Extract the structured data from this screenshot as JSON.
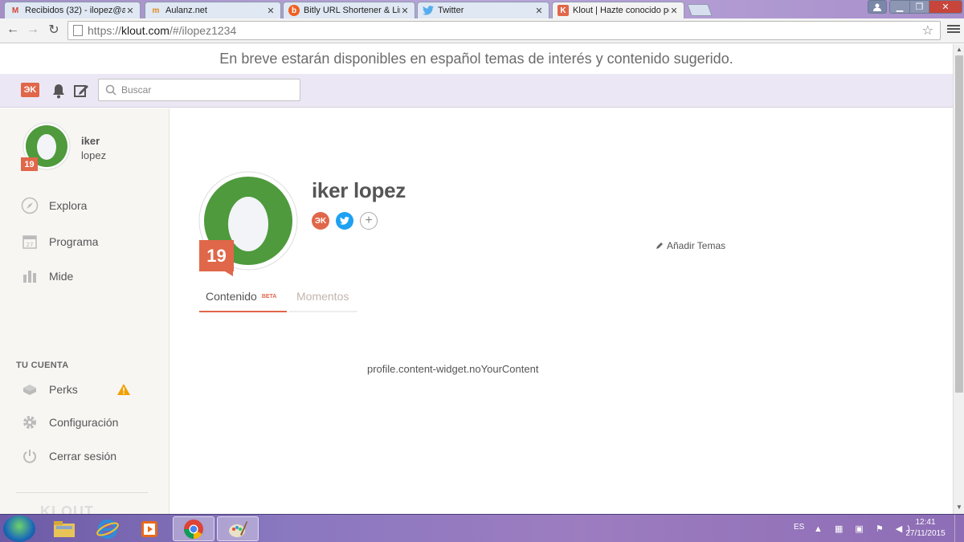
{
  "browser": {
    "tabs": [
      {
        "title": "Recibidos (32) - ilopez@a",
        "icon": "gmail-icon",
        "icon_glyph": "M",
        "icon_color": "#d44638"
      },
      {
        "title": "Aulanz.net",
        "icon": "aulanz-icon",
        "icon_glyph": "m",
        "icon_color": "#e08c1c"
      },
      {
        "title": "Bitly URL Shortener & Lin",
        "icon": "bitly-icon",
        "icon_glyph": "b",
        "icon_color": "#ee6123"
      },
      {
        "title": "Twitter",
        "icon": "twitter-icon",
        "icon_glyph": "t",
        "icon_color": "#55acee"
      },
      {
        "title": "Klout | Hazte conocido po",
        "icon": "klout-icon",
        "icon_glyph": "K",
        "icon_color": "#e0674a",
        "active": true
      }
    ],
    "url_prefix": "https://",
    "url_host": "klout.com",
    "url_path": "/#/ilopez1234"
  },
  "page": {
    "banner": "En breve estarán disponibles en español temas de interés y contenido sugerido.",
    "search_placeholder": "Buscar",
    "accent_color": "#e0674a"
  },
  "sidebar": {
    "first_name": "iker",
    "last_name": "lopez",
    "score": "19",
    "nav": [
      {
        "label": "Explora",
        "icon": "compass-icon"
      },
      {
        "label": "Programa",
        "icon": "calendar-icon"
      },
      {
        "label": "Mide",
        "icon": "bar-chart-icon"
      }
    ],
    "account_heading": "TU CUENTA",
    "account": [
      {
        "label": "Perks",
        "icon": "gift-icon"
      },
      {
        "label": "Configuración",
        "icon": "gear-icon"
      },
      {
        "label": "Cerrar sesión",
        "icon": "power-icon"
      }
    ],
    "footer_logo": "KLOUT"
  },
  "profile": {
    "name": "iker lopez",
    "score": "19",
    "add_topics": "Añadir Temas",
    "tabs": {
      "content": "Contenido",
      "content_badge": "BETA",
      "moments": "Momentos"
    },
    "empty_message": "profile.content-widget.noYourContent"
  },
  "taskbar": {
    "language": "ES",
    "time": "12:41",
    "date": "27/11/2015"
  }
}
